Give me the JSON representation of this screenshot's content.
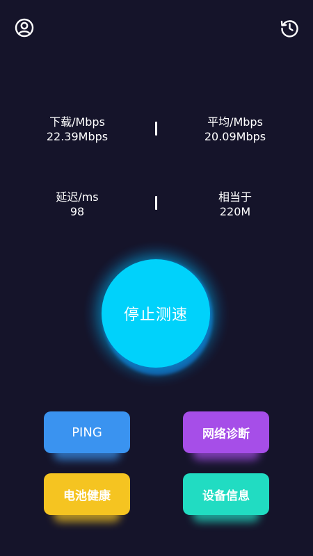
{
  "header": {
    "profile_icon": "user-circle-icon",
    "history_icon": "history-clock-icon"
  },
  "stats": {
    "download": {
      "label": "下载/Mbps",
      "value": "22.39Mbps"
    },
    "average": {
      "label": "平均/Mbps",
      "value": "20.09Mbps"
    },
    "latency": {
      "label": "延迟/ms",
      "value": "98"
    },
    "equivalent": {
      "label": "相当于",
      "value": "220M"
    }
  },
  "main_button": {
    "label": "停止测速",
    "color": "#00d2fb"
  },
  "tools": {
    "ping": {
      "label": "PING",
      "color": "#3a93f0"
    },
    "network": {
      "label": "网络诊断",
      "color": "#a64ee8"
    },
    "battery": {
      "label": "电池健康",
      "color": "#f5c421"
    },
    "device": {
      "label": "设备信息",
      "color": "#21dcc2"
    }
  },
  "colors": {
    "background": "#15142a",
    "text": "#ffffff"
  }
}
